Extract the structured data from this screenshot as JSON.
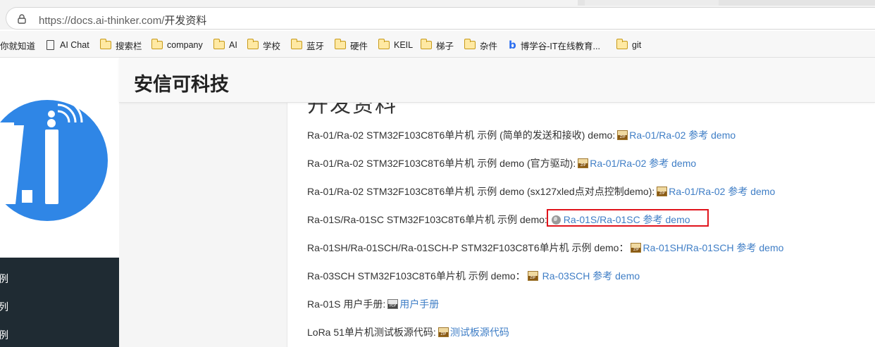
{
  "browser": {
    "url_host": "https://docs.ai-thinker.com/",
    "url_path": "开发资料"
  },
  "bookmarks": [
    {
      "label": "你就知道",
      "icon": "none"
    },
    {
      "label": "AI Chat",
      "icon": "page-icon"
    },
    {
      "label": "搜索栏",
      "icon": "folder-icon"
    },
    {
      "label": "company",
      "icon": "folder-icon"
    },
    {
      "label": "AI",
      "icon": "folder-icon"
    },
    {
      "label": "学校",
      "icon": "folder-icon"
    },
    {
      "label": "蓝牙",
      "icon": "folder-icon"
    },
    {
      "label": "硬件",
      "icon": "folder-icon"
    },
    {
      "label": "KEIL",
      "icon": "folder-icon"
    },
    {
      "label": "梯子",
      "icon": "folder-icon"
    },
    {
      "label": "杂件",
      "icon": "folder-icon"
    },
    {
      "label": "博学谷-IT在线教育...",
      "icon": "bing-icon"
    },
    {
      "label": "git",
      "icon": "folder-icon"
    }
  ],
  "header": {
    "site_title": "安信可科技"
  },
  "sidebar": {
    "logo_text": "A.I",
    "items": [
      {
        "label": "例"
      },
      {
        "label": "列"
      },
      {
        "label": "例"
      }
    ]
  },
  "content": {
    "page_heading_partial": "开发资料",
    "rows": [
      {
        "text": "Ra-01/Ra-02 STM32F103C8T6单片机 示例 (简单的发送和接收) demo:",
        "icon": "zip-icon",
        "link": "Ra-01/Ra-02 参考 demo"
      },
      {
        "text": "Ra-01/Ra-02 STM32F103C8T6单片机 示例 demo (官方驱动):",
        "icon": "zip-icon",
        "link": "Ra-01/Ra-02 参考 demo"
      },
      {
        "text": "Ra-01/Ra-02 STM32F103C8T6单片机 示例 demo (sx127xled点对点控制demo):",
        "icon": "zip-icon",
        "link": "Ra-01/Ra-02 参考 demo"
      },
      {
        "text": "Ra-01S/Ra-01SC STM32F103C8T6单片机 示例 demo:",
        "icon": "globe-icon",
        "link": "Ra-01S/Ra-01SC 参考 demo"
      },
      {
        "text": "Ra-01SH/Ra-01SCH/Ra-01SCH-P STM32F103C8T6单片机 示例 demo：",
        "icon": "zip-icon",
        "link": "Ra-01SH/Ra-01SCH 参考 demo"
      },
      {
        "text": "Ra-03SCH STM32F103C8T6单片机 示例 demo：",
        "icon": "zip-icon",
        "link": "Ra-03SCH 参考 demo"
      },
      {
        "text": "Ra-01S 用户手册:",
        "icon": "pdf-icon",
        "link": "用户手册"
      },
      {
        "text": "LoRa 51单片机测试板源代码:",
        "icon": "zip-icon",
        "link": "测试板源代码"
      }
    ]
  },
  "colors": {
    "link": "#3f7ec6",
    "highlight": "#e0141c",
    "logo_blue": "#2f86e6",
    "sidebar_dark": "#1f2b33"
  }
}
